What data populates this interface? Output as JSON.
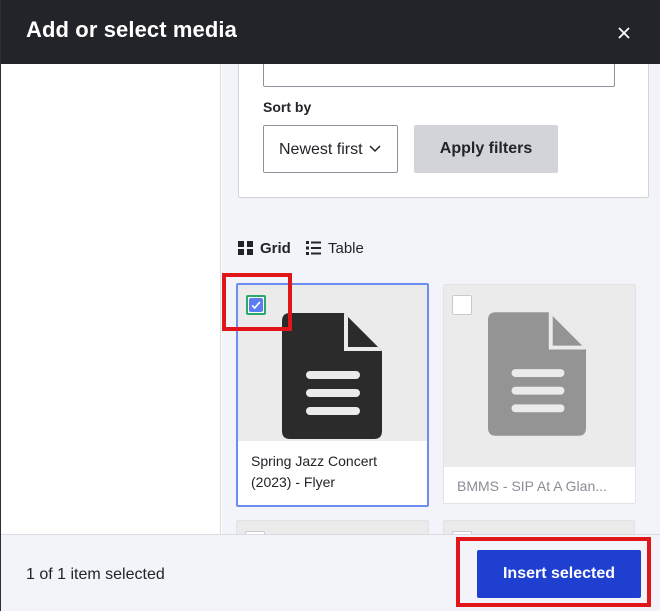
{
  "dialog": {
    "title": "Add or select media",
    "close_icon": "close-icon"
  },
  "filters": {
    "name_value": "",
    "sort_label": "Sort by",
    "sort_selected": "Newest first",
    "apply_label": "Apply filters"
  },
  "views": {
    "grid_label": "Grid",
    "table_label": "Table",
    "active": "Grid"
  },
  "media_items": [
    {
      "caption": "Spring Jazz Concert (2023) - Flyer",
      "selected": true,
      "icon": "document-icon"
    },
    {
      "caption": "BMMS - SIP At A Glan...",
      "selected": false,
      "icon": "document-icon"
    }
  ],
  "footer": {
    "selection_status": "1 of 1 item selected",
    "insert_label": "Insert selected"
  },
  "colors": {
    "titlebar": "#232429",
    "primary_button": "#1f3fd1",
    "selected_border": "#6c8ef0",
    "highlight_box": "#e0161b"
  }
}
